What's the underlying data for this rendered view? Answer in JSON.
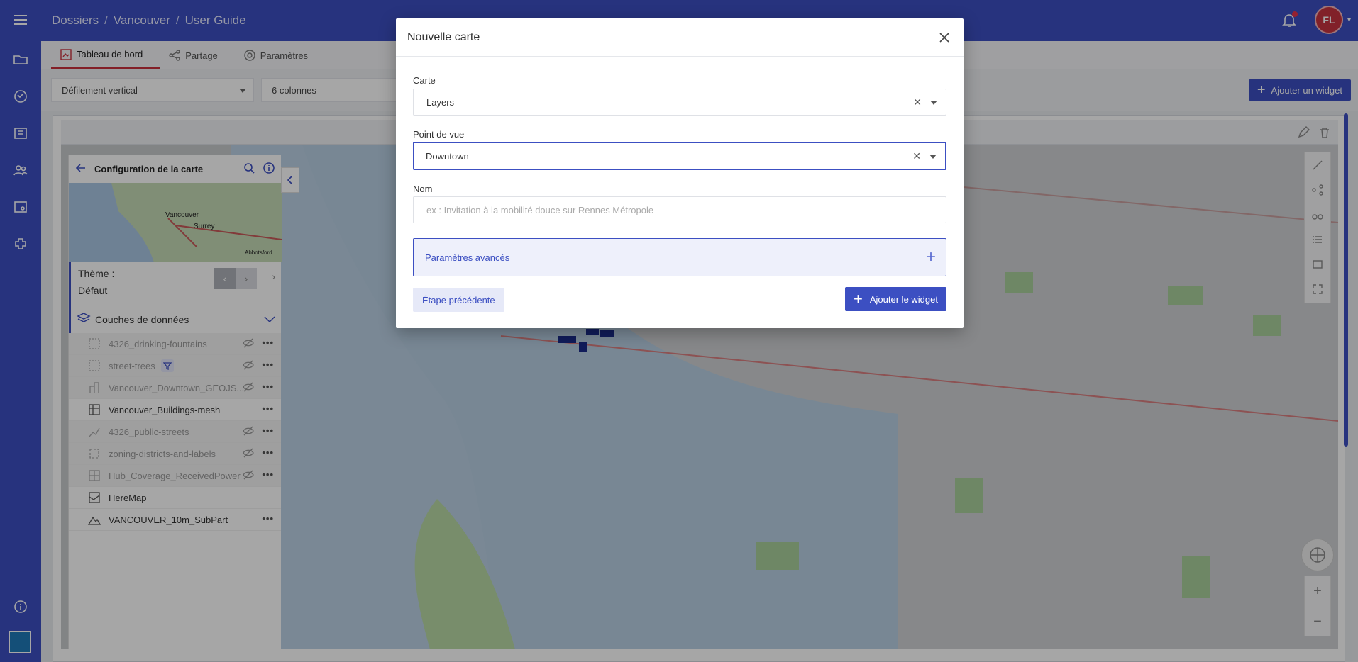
{
  "header": {
    "breadcrumb": [
      "Dossiers",
      "Vancouver",
      "User Guide"
    ],
    "avatar_initials": "FL"
  },
  "tabs": [
    {
      "label": "Tableau de bord",
      "active": true
    },
    {
      "label": "Partage",
      "active": false
    },
    {
      "label": "Paramètres",
      "active": false
    }
  ],
  "toolbar": {
    "scroll_mode": "Défilement vertical",
    "columns": "6 colonnes",
    "add_widget_label": "Ajouter un widget"
  },
  "panel": {
    "title": "Configuration de la carte",
    "theme_label": "Thème :",
    "theme_value": "Défaut",
    "layers_title": "Couches de données",
    "layers": [
      {
        "name": "4326_drinking-fountains",
        "hidden": true,
        "icon": "raster-icon"
      },
      {
        "name": "street-trees",
        "hidden": true,
        "icon": "raster-icon",
        "filter": true
      },
      {
        "name": "Vancouver_Downtown_GEOJS...",
        "hidden": true,
        "icon": "building-icon"
      },
      {
        "name": "Vancouver_Buildings-mesh",
        "hidden": false,
        "icon": "mesh-icon"
      },
      {
        "name": "4326_public-streets",
        "hidden": true,
        "icon": "line-icon"
      },
      {
        "name": "zoning-districts-and-labels",
        "hidden": true,
        "icon": "polygon-icon"
      },
      {
        "name": "Hub_Coverage_ReceivedPower",
        "hidden": true,
        "icon": "heatmap-icon"
      },
      {
        "name": "HereMap",
        "hidden": false,
        "icon": "basemap-icon",
        "no_menu": true
      },
      {
        "name": "VANCOUVER_10m_SubPart",
        "hidden": false,
        "icon": "terrain-icon"
      }
    ],
    "map_labels": [
      "Vancouver",
      "Surrey",
      "Abbotsford"
    ]
  },
  "modal": {
    "title": "Nouvelle carte",
    "map_label": "Carte",
    "map_value": "Layers",
    "viewpoint_label": "Point de vue",
    "viewpoint_value": "Downtown",
    "name_label": "Nom",
    "name_placeholder": "ex : Invitation à la mobilité douce sur Rennes Métropole",
    "advanced_label": "Paramètres avancés",
    "prev_label": "Étape précédente",
    "add_label": "Ajouter le widget"
  },
  "colors": {
    "primary": "#3c4fc2",
    "accent_red": "#c9303c"
  }
}
